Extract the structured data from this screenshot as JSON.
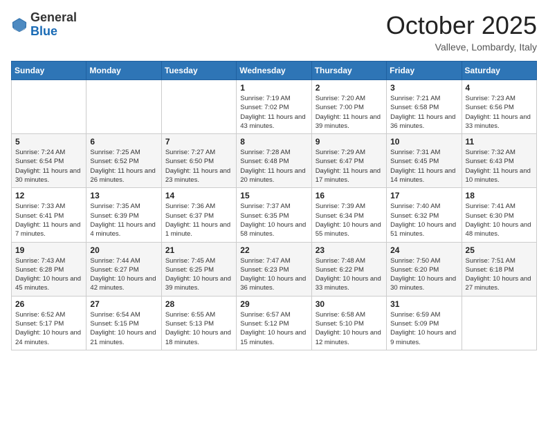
{
  "header": {
    "logo_line1": "General",
    "logo_line2": "Blue",
    "month": "October 2025",
    "location": "Valleve, Lombardy, Italy"
  },
  "weekdays": [
    "Sunday",
    "Monday",
    "Tuesday",
    "Wednesday",
    "Thursday",
    "Friday",
    "Saturday"
  ],
  "weeks": [
    [
      {
        "day": "",
        "info": ""
      },
      {
        "day": "",
        "info": ""
      },
      {
        "day": "",
        "info": ""
      },
      {
        "day": "1",
        "info": "Sunrise: 7:19 AM\nSunset: 7:02 PM\nDaylight: 11 hours and 43 minutes."
      },
      {
        "day": "2",
        "info": "Sunrise: 7:20 AM\nSunset: 7:00 PM\nDaylight: 11 hours and 39 minutes."
      },
      {
        "day": "3",
        "info": "Sunrise: 7:21 AM\nSunset: 6:58 PM\nDaylight: 11 hours and 36 minutes."
      },
      {
        "day": "4",
        "info": "Sunrise: 7:23 AM\nSunset: 6:56 PM\nDaylight: 11 hours and 33 minutes."
      }
    ],
    [
      {
        "day": "5",
        "info": "Sunrise: 7:24 AM\nSunset: 6:54 PM\nDaylight: 11 hours and 30 minutes."
      },
      {
        "day": "6",
        "info": "Sunrise: 7:25 AM\nSunset: 6:52 PM\nDaylight: 11 hours and 26 minutes."
      },
      {
        "day": "7",
        "info": "Sunrise: 7:27 AM\nSunset: 6:50 PM\nDaylight: 11 hours and 23 minutes."
      },
      {
        "day": "8",
        "info": "Sunrise: 7:28 AM\nSunset: 6:48 PM\nDaylight: 11 hours and 20 minutes."
      },
      {
        "day": "9",
        "info": "Sunrise: 7:29 AM\nSunset: 6:47 PM\nDaylight: 11 hours and 17 minutes."
      },
      {
        "day": "10",
        "info": "Sunrise: 7:31 AM\nSunset: 6:45 PM\nDaylight: 11 hours and 14 minutes."
      },
      {
        "day": "11",
        "info": "Sunrise: 7:32 AM\nSunset: 6:43 PM\nDaylight: 11 hours and 10 minutes."
      }
    ],
    [
      {
        "day": "12",
        "info": "Sunrise: 7:33 AM\nSunset: 6:41 PM\nDaylight: 11 hours and 7 minutes."
      },
      {
        "day": "13",
        "info": "Sunrise: 7:35 AM\nSunset: 6:39 PM\nDaylight: 11 hours and 4 minutes."
      },
      {
        "day": "14",
        "info": "Sunrise: 7:36 AM\nSunset: 6:37 PM\nDaylight: 11 hours and 1 minute."
      },
      {
        "day": "15",
        "info": "Sunrise: 7:37 AM\nSunset: 6:35 PM\nDaylight: 10 hours and 58 minutes."
      },
      {
        "day": "16",
        "info": "Sunrise: 7:39 AM\nSunset: 6:34 PM\nDaylight: 10 hours and 55 minutes."
      },
      {
        "day": "17",
        "info": "Sunrise: 7:40 AM\nSunset: 6:32 PM\nDaylight: 10 hours and 51 minutes."
      },
      {
        "day": "18",
        "info": "Sunrise: 7:41 AM\nSunset: 6:30 PM\nDaylight: 10 hours and 48 minutes."
      }
    ],
    [
      {
        "day": "19",
        "info": "Sunrise: 7:43 AM\nSunset: 6:28 PM\nDaylight: 10 hours and 45 minutes."
      },
      {
        "day": "20",
        "info": "Sunrise: 7:44 AM\nSunset: 6:27 PM\nDaylight: 10 hours and 42 minutes."
      },
      {
        "day": "21",
        "info": "Sunrise: 7:45 AM\nSunset: 6:25 PM\nDaylight: 10 hours and 39 minutes."
      },
      {
        "day": "22",
        "info": "Sunrise: 7:47 AM\nSunset: 6:23 PM\nDaylight: 10 hours and 36 minutes."
      },
      {
        "day": "23",
        "info": "Sunrise: 7:48 AM\nSunset: 6:22 PM\nDaylight: 10 hours and 33 minutes."
      },
      {
        "day": "24",
        "info": "Sunrise: 7:50 AM\nSunset: 6:20 PM\nDaylight: 10 hours and 30 minutes."
      },
      {
        "day": "25",
        "info": "Sunrise: 7:51 AM\nSunset: 6:18 PM\nDaylight: 10 hours and 27 minutes."
      }
    ],
    [
      {
        "day": "26",
        "info": "Sunrise: 6:52 AM\nSunset: 5:17 PM\nDaylight: 10 hours and 24 minutes."
      },
      {
        "day": "27",
        "info": "Sunrise: 6:54 AM\nSunset: 5:15 PM\nDaylight: 10 hours and 21 minutes."
      },
      {
        "day": "28",
        "info": "Sunrise: 6:55 AM\nSunset: 5:13 PM\nDaylight: 10 hours and 18 minutes."
      },
      {
        "day": "29",
        "info": "Sunrise: 6:57 AM\nSunset: 5:12 PM\nDaylight: 10 hours and 15 minutes."
      },
      {
        "day": "30",
        "info": "Sunrise: 6:58 AM\nSunset: 5:10 PM\nDaylight: 10 hours and 12 minutes."
      },
      {
        "day": "31",
        "info": "Sunrise: 6:59 AM\nSunset: 5:09 PM\nDaylight: 10 hours and 9 minutes."
      },
      {
        "day": "",
        "info": ""
      }
    ]
  ]
}
